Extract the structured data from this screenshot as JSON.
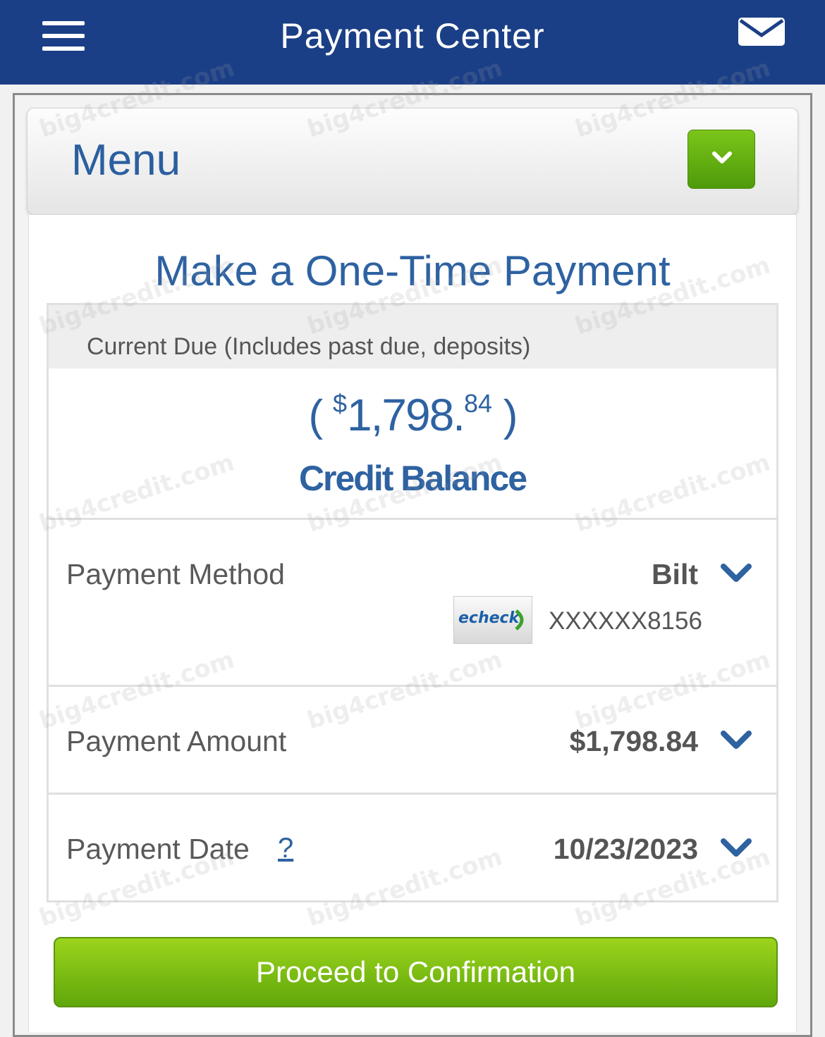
{
  "header": {
    "title": "Payment Center",
    "menu_icon": "hamburger-menu-icon",
    "mail_icon": "envelope-icon",
    "background_color": "#1b3f86"
  },
  "menu": {
    "label": "Menu",
    "toggle_icon": "chevron-down-icon",
    "toggle_color": "#6bb512"
  },
  "payment": {
    "title": "Make a One-Time Payment",
    "current_due_label": "Current Due (Includes past due, deposits)",
    "amount_open": "(",
    "amount_currency": "$",
    "amount_whole": "1,798.",
    "amount_cents": "84",
    "amount_close": ")",
    "balance_type": "Credit Balance",
    "method": {
      "label": "Payment Method",
      "value": "Bilt",
      "logo_text": "echeck",
      "account": "XXXXXX8156"
    },
    "amount": {
      "label": "Payment Amount",
      "value": "$1,798.84"
    },
    "date": {
      "label": "Payment Date",
      "help": "?",
      "value": "10/23/2023"
    },
    "proceed_label": "Proceed to Confirmation"
  },
  "watermark": "big4credit.com"
}
